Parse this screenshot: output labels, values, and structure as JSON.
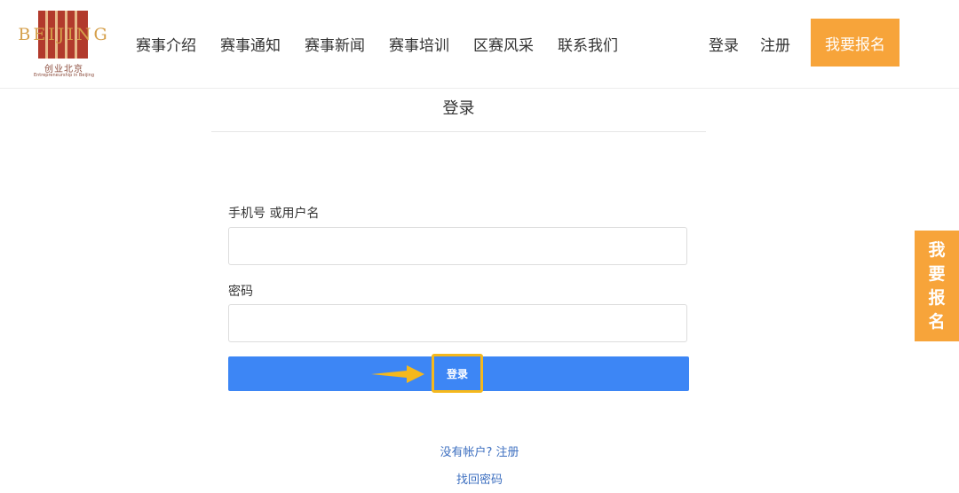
{
  "header": {
    "logo": {
      "word": "BEIJING",
      "cn": "创业北京",
      "en": "Entrepreneurship in Beijing"
    },
    "nav": [
      {
        "label": "赛事介绍"
      },
      {
        "label": "赛事通知"
      },
      {
        "label": "赛事新闻"
      },
      {
        "label": "赛事培训"
      },
      {
        "label": "区赛风采"
      },
      {
        "label": "联系我们"
      }
    ],
    "login_label": "登录",
    "register_label": "注册",
    "signup_label": "我要报名"
  },
  "page": {
    "title": "登录"
  },
  "form": {
    "username_label": "手机号 或用户名",
    "username_value": "",
    "password_label": "密码",
    "password_value": "",
    "submit_label": "登录"
  },
  "links": {
    "no_account": "没有帐户? 注册",
    "recover": "找回密码"
  },
  "side_tab": {
    "chars": [
      "我",
      "要",
      "报",
      "名"
    ]
  },
  "colors": {
    "accent_orange": "#f7a43a",
    "button_blue": "#3d86f5",
    "highlight_yellow": "#f5b81c",
    "link_blue": "#3d6fc0"
  }
}
